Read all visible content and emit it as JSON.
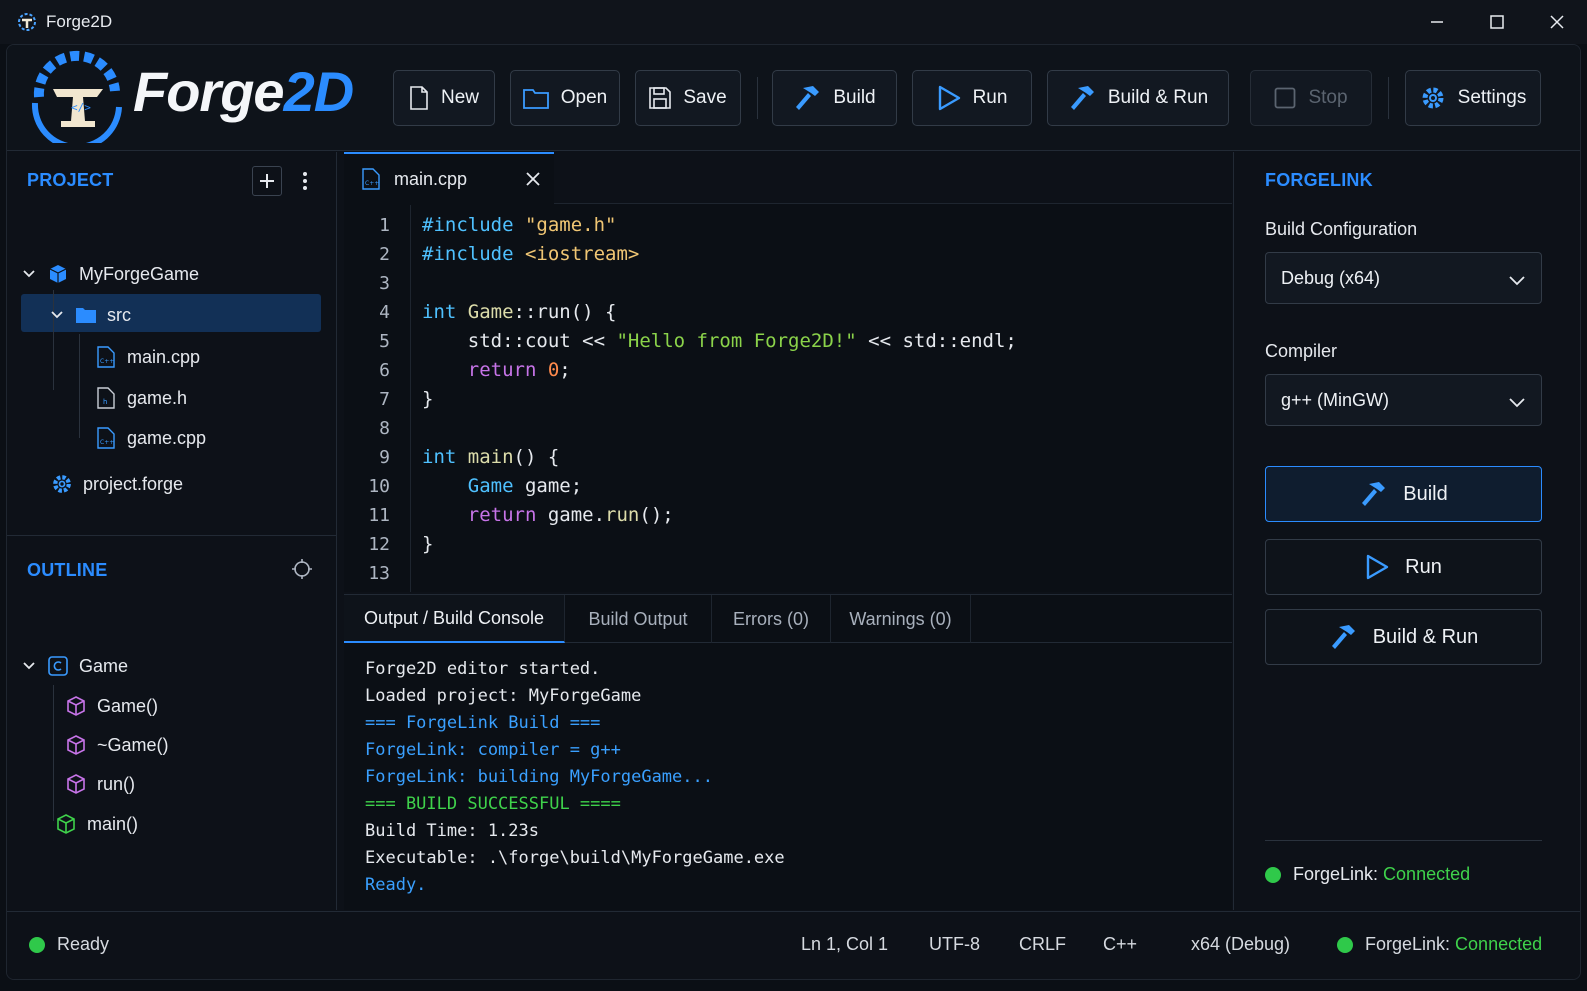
{
  "window": {
    "title": "Forge2D"
  },
  "logo": {
    "text_main": "Forge",
    "text_accent": "2D"
  },
  "toolbar": {
    "new_label": "New",
    "open_label": "Open",
    "save_label": "Save",
    "build_label": "Build",
    "run_label": "Run",
    "build_run_label": "Build & Run",
    "stop_label": "Stop",
    "settings_label": "Settings"
  },
  "project": {
    "title": "PROJECT",
    "root": "MyForgeGame",
    "folder": "src",
    "files": [
      "main.cpp",
      "game.h",
      "game.cpp"
    ],
    "config_file": "project.forge"
  },
  "outline": {
    "title": "OUTLINE",
    "class_name": "Game",
    "members": [
      "Game()",
      "~Game()",
      "run()"
    ],
    "functions": [
      "main()"
    ]
  },
  "editor": {
    "tab_label": "main.cpp",
    "line_numbers": [
      "1",
      "2",
      "3",
      "4",
      "5",
      "6",
      "7",
      "8",
      "9",
      "10",
      "11",
      "12",
      "13"
    ],
    "code": {
      "l1_pp": "#include ",
      "l1_str": "\"game.h\"",
      "l2_pp": "#include ",
      "l2_str": "<iostream>",
      "l4_kw": "int ",
      "l4_ty": "Game",
      "l4_rest": "::run() {",
      "l5_a": "    std::cout << ",
      "l5_str": "\"Hello from Forge2D!\"",
      "l5_b": " << std::endl;",
      "l6_kw": "    return ",
      "l6_num": "0",
      "l6_end": ";",
      "l7": "}",
      "l9_kw": "int ",
      "l9_fn": "main",
      "l9_rest": "() {",
      "l10_ty": "    Game",
      "l10_rest": " game;",
      "l11_kw": "    return ",
      "l11_a": "game.",
      "l11_fn": "run",
      "l11_b": "();",
      "l12": "}"
    }
  },
  "console": {
    "tabs": [
      "Output / Build Console",
      "Build Output",
      "Errors (0)",
      "Warnings (0)"
    ],
    "lines": [
      "Forge2D editor started.",
      "Loaded project: MyForgeGame",
      "=== ForgeLink Build ===",
      "ForgeLink: compiler = g++",
      "ForgeLink: building MyForgeGame...",
      "=== BUILD SUCCESSFUL ====",
      "Build Time: 1.23s",
      "Executable: .\\forge\\build\\MyForgeGame.exe",
      "Ready."
    ]
  },
  "forgelink": {
    "title": "FORGELINK",
    "build_config_label": "Build Configuration",
    "build_config_value": "Debug (x64)",
    "compiler_label": "Compiler",
    "compiler_value": "g++ (MinGW)",
    "build_label": "Build",
    "run_label": "Run",
    "build_run_label": "Build & Run",
    "status_label": "ForgeLink: ",
    "status_value": "Connected"
  },
  "statusbar": {
    "ready": "Ready",
    "position": "Ln 1, Col 1",
    "encoding": "UTF-8",
    "line_ending": "CRLF",
    "language": "C++",
    "target": "x64 (Debug)",
    "link_label": "ForgeLink: ",
    "link_value": "Connected"
  },
  "colors": {
    "accent": "#2b8cff",
    "success": "#3fd24b",
    "keyword": "#c774e8",
    "type": "#4fc1ff",
    "string": "#f0c674"
  }
}
